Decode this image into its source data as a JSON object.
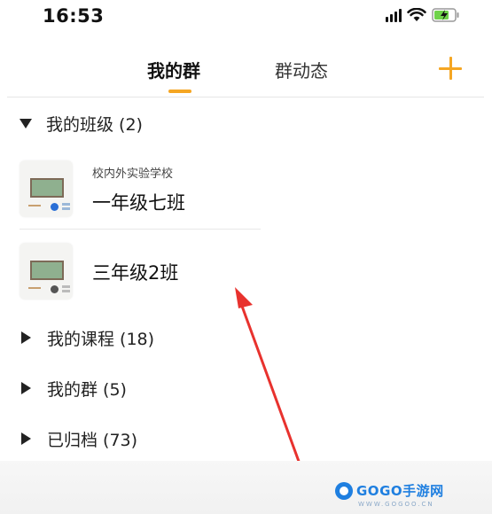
{
  "status_bar": {
    "time": "16:53"
  },
  "header": {
    "tabs": [
      {
        "label": "我的群",
        "active": true
      },
      {
        "label": "群动态",
        "active": false
      }
    ],
    "add_icon": "plus-icon"
  },
  "sections": [
    {
      "label": "我的班级 (2)",
      "expanded": true
    },
    {
      "label": "我的课程 (18)",
      "expanded": false
    },
    {
      "label": "我的群 (5)",
      "expanded": false
    },
    {
      "label": "已归档 (73)",
      "expanded": false
    }
  ],
  "classes": [
    {
      "school": "校内外实验学校",
      "name": "一年级七班"
    },
    {
      "school": "",
      "name": "三年级2班"
    }
  ],
  "watermark": {
    "text": "GOGO手游网",
    "sub": "WWW.GOGOO.CN"
  },
  "colors": {
    "accent": "#f5a623",
    "arrow": "#e8322e"
  }
}
